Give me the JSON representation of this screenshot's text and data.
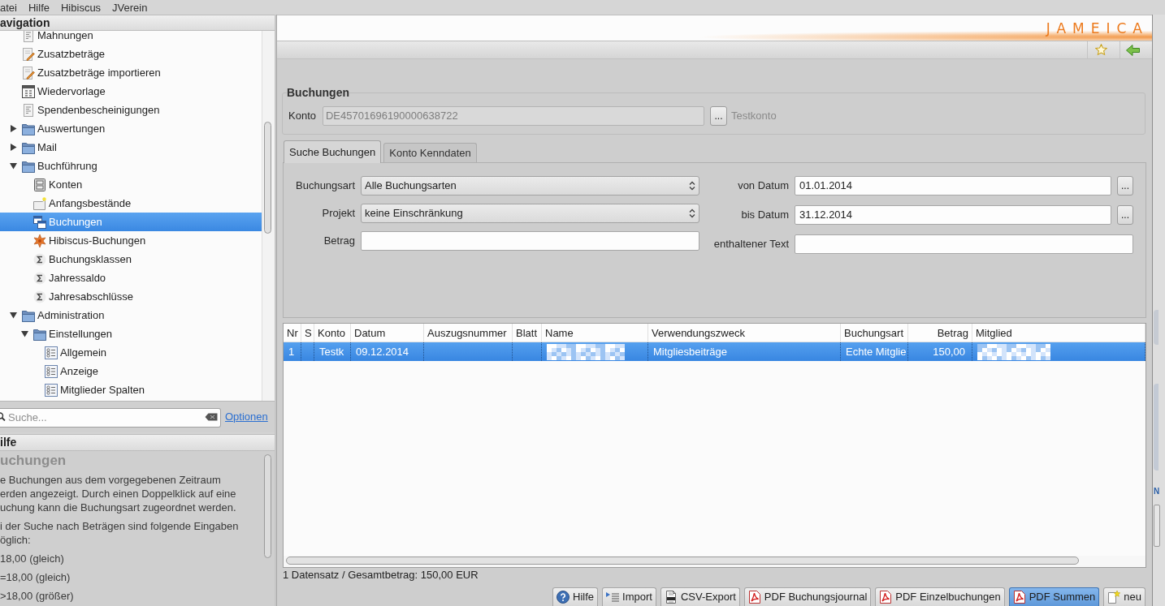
{
  "menu_bar": [
    {
      "label": "atei"
    },
    {
      "label": "Hilfe"
    },
    {
      "label": "Hibiscus"
    },
    {
      "label": "JVerein"
    }
  ],
  "navigation": {
    "title": "avigation",
    "tree": [
      {
        "label": "Mahnungen",
        "kind": "list",
        "selected": false
      },
      {
        "label": "Zusatzbeträge",
        "kind": "edit",
        "selected": false
      },
      {
        "label": "Zusatzbeträge importieren",
        "kind": "edit",
        "selected": false
      },
      {
        "label": "Wiedervorlage",
        "kind": "calendar",
        "selected": false
      },
      {
        "label": "Spendenbescheinigungen",
        "kind": "list",
        "selected": false
      },
      {
        "label": "Auswertungen",
        "kind": "folder",
        "expanded": false,
        "selected": false
      },
      {
        "label": "Mail",
        "kind": "folder",
        "expanded": false,
        "selected": false
      },
      {
        "label": "Buchführung",
        "kind": "folder",
        "expanded": true,
        "selected": false,
        "children": [
          {
            "label": "Konten",
            "kind": "cabinet",
            "selected": false
          },
          {
            "label": "Anfangsbestände",
            "kind": "note",
            "selected": false
          },
          {
            "label": "Buchungen",
            "kind": "windows",
            "selected": true
          },
          {
            "label": "Hibiscus-Buchungen",
            "kind": "flower",
            "selected": false
          },
          {
            "label": "Buchungsklassen",
            "kind": "sigma",
            "selected": false
          },
          {
            "label": "Jahressaldo",
            "kind": "sigma",
            "selected": false
          },
          {
            "label": "Jahresabschlüsse",
            "kind": "sigma",
            "selected": false
          }
        ]
      },
      {
        "label": "Administration",
        "kind": "folder",
        "expanded": true,
        "selected": false,
        "children": [
          {
            "label": "Einstellungen",
            "kind": "folder",
            "expanded": true,
            "selected": false,
            "children": [
              {
                "label": "Allgemein",
                "kind": "settings",
                "selected": false
              },
              {
                "label": "Anzeige",
                "kind": "settings",
                "selected": false
              },
              {
                "label": "Mitglieder Spalten",
                "kind": "settings",
                "selected": false
              }
            ]
          }
        ]
      }
    ],
    "search": {
      "placeholder": "Suche..."
    },
    "options_link": "Optionen"
  },
  "help": {
    "title": "ilfe",
    "heading": "uchungen",
    "paragraphs": [
      [
        "e Buchungen aus dem vorgegebenen Zeitraum",
        "erden angezeigt. Durch einen Doppelklick auf eine",
        "uchung kann die Buchungsart zugeordnet werden."
      ],
      [
        "i der Suche nach Beträgen sind folgende Eingaben",
        "öglich:"
      ],
      [
        "18,00 (gleich)"
      ],
      [
        "=18,00 (gleich)"
      ],
      [
        ">18,00 (größer)"
      ]
    ]
  },
  "banner": {
    "logo": "JAMEICA"
  },
  "form": {
    "title": "Buchungen",
    "konto": {
      "label": "Konto",
      "value": "DE45701696190000638722",
      "disabled": true,
      "button": "...",
      "name": "Testkonto"
    }
  },
  "tabs": [
    {
      "label": "Suche Buchungen",
      "selected": true
    },
    {
      "label": "Konto Kenndaten",
      "selected": false
    }
  ],
  "filters": {
    "left": [
      {
        "kind": "select",
        "label": "Buchungsart",
        "value": "Alle Buchungsarten"
      },
      {
        "kind": "select",
        "label": "Projekt",
        "value": "keine Einschränkung"
      },
      {
        "kind": "text",
        "label": "Betrag"
      }
    ],
    "right": [
      {
        "kind": "date",
        "label": "von Datum",
        "value": "01.01.2014",
        "button": "..."
      },
      {
        "kind": "date",
        "label": "bis Datum",
        "value": "31.12.2014",
        "button": "..."
      },
      {
        "kind": "text",
        "label": "enthaltener Text"
      }
    ]
  },
  "table": {
    "columns": [
      {
        "label": "Nr",
        "kind": "text"
      },
      {
        "label": "S",
        "kind": "text"
      },
      {
        "label": "Konto",
        "kind": "text"
      },
      {
        "label": "Datum",
        "kind": "text"
      },
      {
        "label": "Auszugsnummer",
        "kind": "text"
      },
      {
        "label": "Blatt",
        "kind": "text"
      },
      {
        "label": "Name",
        "kind": "text"
      },
      {
        "label": "Verwendungszweck",
        "kind": "text"
      },
      {
        "label": "Buchungsart",
        "kind": "text"
      },
      {
        "label": "Betrag",
        "kind": "amount"
      },
      {
        "label": "Mitglied",
        "kind": "text"
      }
    ],
    "rows": [
      {
        "selected": true,
        "cells": [
          {
            "kind": "text",
            "text": "1"
          },
          {
            "kind": "empty"
          },
          {
            "kind": "text",
            "text": "Testk"
          },
          {
            "kind": "text",
            "text": "09.12.2014"
          },
          {
            "kind": "empty"
          },
          {
            "kind": "empty"
          },
          {
            "kind": "blurred"
          },
          {
            "kind": "text",
            "text": "Mitgliesbeiträge"
          },
          {
            "kind": "text",
            "text": "Echte Mitglie"
          },
          {
            "kind": "text",
            "text": "150,00"
          },
          {
            "kind": "blurred"
          }
        ]
      }
    ]
  },
  "status_bar": "1 Datensatz / Gesamtbetrag: 150,00 EUR",
  "buttons": [
    {
      "label": "Hilfe",
      "kind": "help",
      "default": false
    },
    {
      "label": "Import",
      "kind": "import",
      "default": false
    },
    {
      "label": "CSV-Export",
      "kind": "csv",
      "default": false
    },
    {
      "label": "PDF Buchungsjournal",
      "kind": "pdf",
      "default": false
    },
    {
      "label": "PDF Einzelbuchungen",
      "kind": "pdf",
      "default": false
    },
    {
      "label": "PDF Summen",
      "kind": "pdf",
      "default": true
    },
    {
      "label": "neu",
      "kind": "new",
      "default": false
    }
  ],
  "background_window": {
    "text": "N"
  }
}
